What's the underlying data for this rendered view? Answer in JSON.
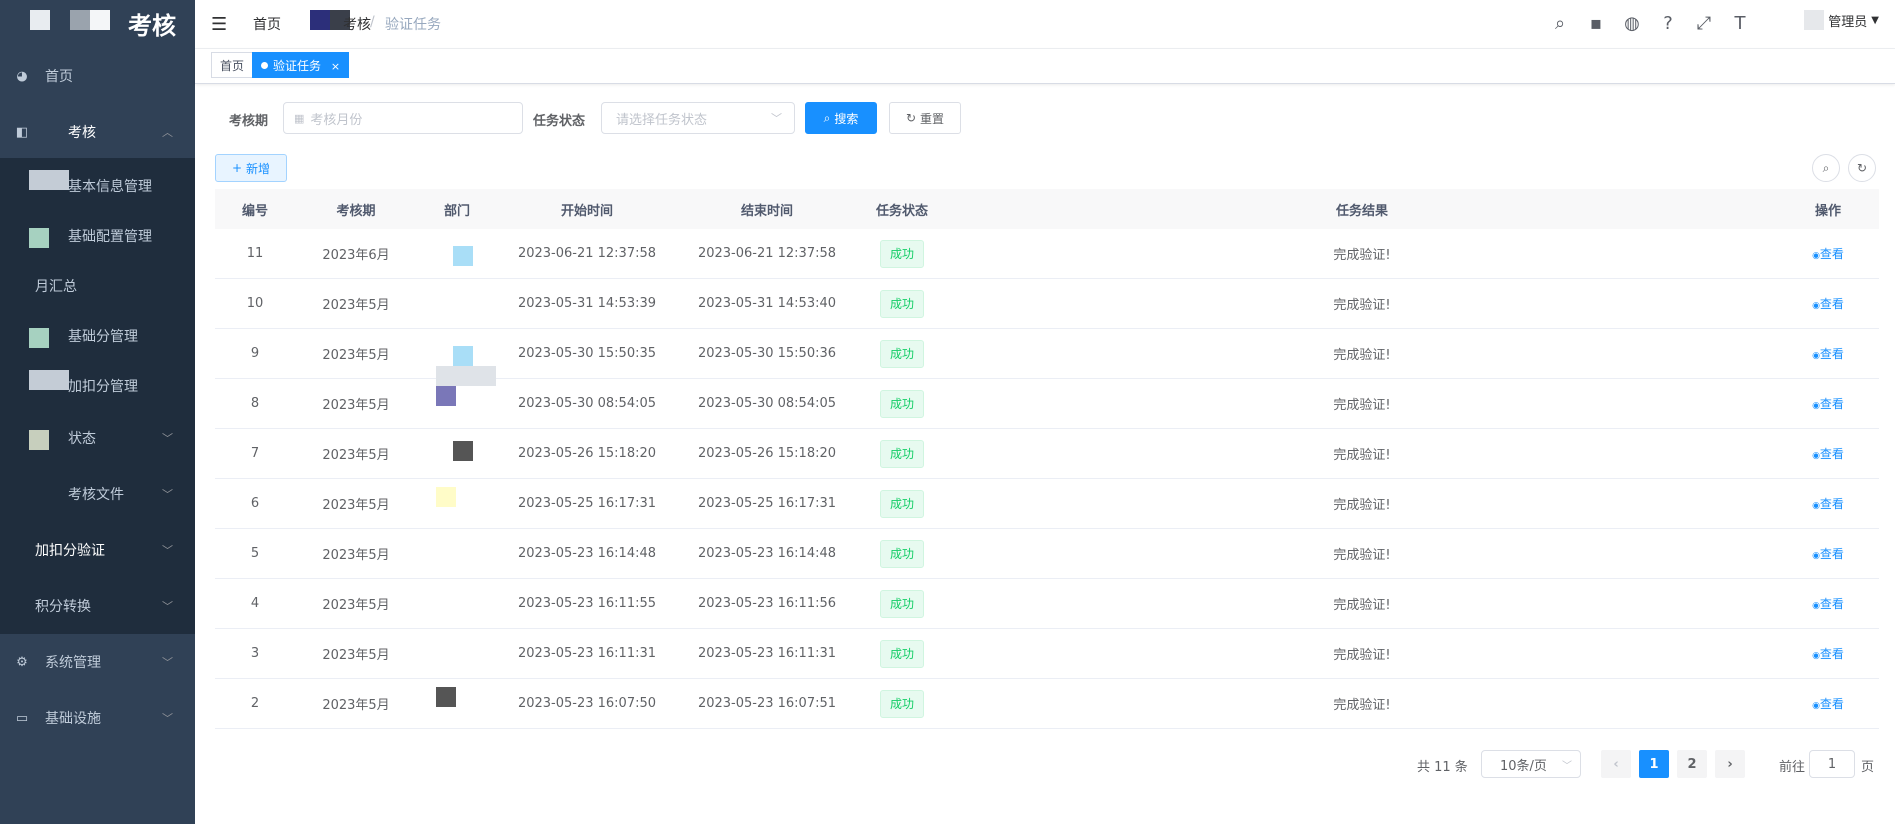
{
  "sidebar": {
    "title": "考核",
    "items": [
      {
        "label": "首页",
        "icon": "dashboard-icon"
      },
      {
        "label": "考核",
        "icon": "book-icon"
      },
      {
        "label": "基本信息管理"
      },
      {
        "label": "基础配置管理"
      },
      {
        "label": "月汇总"
      },
      {
        "label": "基础分管理"
      },
      {
        "label": "加扣分管理"
      },
      {
        "label": "状态"
      },
      {
        "label": "考核文件"
      },
      {
        "label": "加扣分验证"
      },
      {
        "label": "积分转换"
      },
      {
        "label": "系统管理",
        "icon": "gear-icon"
      },
      {
        "label": "基础设施",
        "icon": "monitor-icon"
      }
    ]
  },
  "navbar": {
    "breadcrumb": [
      "首页",
      "考核",
      "验证任务"
    ],
    "user": "管理员"
  },
  "tags": [
    {
      "label": "首页",
      "active": false
    },
    {
      "label": "验证任务",
      "active": true
    }
  ],
  "search": {
    "period_label": "考核期",
    "period_placeholder": "考核月份",
    "status_label": "任务状态",
    "status_placeholder": "请选择任务状态",
    "search_btn": "搜索",
    "reset_btn": "重置"
  },
  "toolbar": {
    "add_btn": "新增"
  },
  "table": {
    "headers": [
      "编号",
      "考核期",
      "部门",
      "开始时间",
      "结束时间",
      "任务状态",
      "任务结果",
      "操作"
    ],
    "rows": [
      {
        "id": "11",
        "period": "2023年6月",
        "start": "2023-06-21 12:37:58",
        "end": "2023-06-21 12:37:58",
        "status": "成功",
        "result": "完成验证!",
        "action": "查看"
      },
      {
        "id": "10",
        "period": "2023年5月",
        "start": "2023-05-31 14:53:39",
        "end": "2023-05-31 14:53:40",
        "status": "成功",
        "result": "完成验证!",
        "action": "查看"
      },
      {
        "id": "9",
        "period": "2023年5月",
        "start": "2023-05-30 15:50:35",
        "end": "2023-05-30 15:50:36",
        "status": "成功",
        "result": "完成验证!",
        "action": "查看"
      },
      {
        "id": "8",
        "period": "2023年5月",
        "start": "2023-05-30 08:54:05",
        "end": "2023-05-30 08:54:05",
        "status": "成功",
        "result": "完成验证!",
        "action": "查看"
      },
      {
        "id": "7",
        "period": "2023年5月",
        "start": "2023-05-26 15:18:20",
        "end": "2023-05-26 15:18:20",
        "status": "成功",
        "result": "完成验证!",
        "action": "查看"
      },
      {
        "id": "6",
        "period": "2023年5月",
        "start": "2023-05-25 16:17:31",
        "end": "2023-05-25 16:17:31",
        "status": "成功",
        "result": "完成验证!",
        "action": "查看"
      },
      {
        "id": "5",
        "period": "2023年5月",
        "start": "2023-05-23 16:14:48",
        "end": "2023-05-23 16:14:48",
        "status": "成功",
        "result": "完成验证!",
        "action": "查看"
      },
      {
        "id": "4",
        "period": "2023年5月",
        "start": "2023-05-23 16:11:55",
        "end": "2023-05-23 16:11:56",
        "status": "成功",
        "result": "完成验证!",
        "action": "查看"
      },
      {
        "id": "3",
        "period": "2023年5月",
        "start": "2023-05-23 16:11:31",
        "end": "2023-05-23 16:11:31",
        "status": "成功",
        "result": "完成验证!",
        "action": "查看"
      },
      {
        "id": "2",
        "period": "2023年5月",
        "start": "2023-05-23 16:07:50",
        "end": "2023-05-23 16:07:51",
        "status": "成功",
        "result": "完成验证!",
        "action": "查看"
      }
    ]
  },
  "pagination": {
    "total": "共 11 条",
    "page_size": "10条/页",
    "pages": [
      "1",
      "2"
    ],
    "current": "1",
    "goto_prefix": "前往",
    "goto_value": "1",
    "goto_suffix": "页"
  },
  "colors": {
    "sidebar_bg": "#304156",
    "primary": "#1890ff",
    "success": "#13ce66"
  }
}
